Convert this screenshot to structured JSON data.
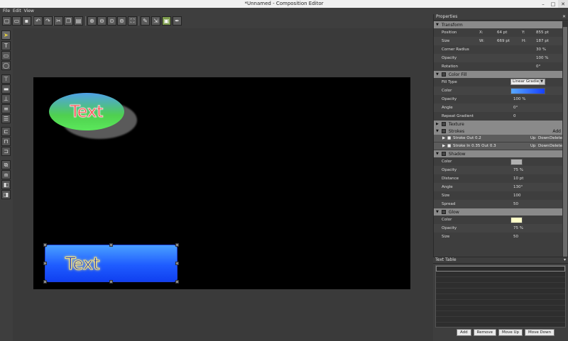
{
  "window": {
    "title": "*Unnamed - Composition Editor",
    "minimize": "–",
    "maximize": "□",
    "close": "✕"
  },
  "menu": [
    "File",
    "Edit",
    "View"
  ],
  "toolbar_icons": [
    "new-doc-icon",
    "open-folder-icon",
    "save-icon",
    "undo-icon",
    "redo-icon",
    "cut-icon",
    "copy-icon",
    "paste-icon",
    "zoom-in-icon",
    "zoom-out-icon",
    "zoom-fit-icon",
    "zoom-actual-icon",
    "fullscreen-icon",
    "edit-icon",
    "export-icon",
    "image-icon",
    "eyedropper-icon"
  ],
  "canvas": {
    "ellipse_text": "Text",
    "rect_text": "Text"
  },
  "properties": {
    "title": "Properties",
    "transform": {
      "label": "Transform",
      "position_label": "Position",
      "x_label": "X:",
      "x_value": "64 pt",
      "y_label": "Y:",
      "y_value": "855 pt",
      "size_label": "Size",
      "w_label": "W:",
      "w_value": "669 pt",
      "h_label": "H:",
      "h_value": "187 pt",
      "corner_label": "Corner Radius",
      "corner_value": "30 %",
      "opacity_label": "Opacity",
      "opacity_value": "100 %",
      "rotation_label": "Rotation",
      "rotation_value": "0°"
    },
    "color_fill": {
      "label": "Color Fill",
      "fill_type_label": "Fill Type",
      "fill_type_value": "Linear Gradient",
      "color_label": "Color",
      "opacity_label": "Opacity",
      "opacity_value": "100 %",
      "angle_label": "Angle",
      "angle_value": "0°",
      "repeat_label": "Repeat Gradient",
      "repeat_value": "0"
    },
    "texture": {
      "label": "Texture"
    },
    "strokes": {
      "label": "Strokes",
      "add": "Add",
      "items": [
        {
          "name": "Stroke Out 0.2",
          "up": "Up",
          "down": "Down",
          "del": "Delete"
        },
        {
          "name": "Stroke In 0.35 Out 0.3",
          "up": "Up",
          "down": "Down",
          "del": "Delete"
        }
      ]
    },
    "shadow": {
      "label": "Shadow",
      "color_label": "Color",
      "opacity_label": "Opacity",
      "opacity_value": "75 %",
      "distance_label": "Distance",
      "distance_value": "10 pt",
      "angle_label": "Angle",
      "angle_value": "130°",
      "size_label": "Size",
      "size_value": "100",
      "spread_label": "Spread",
      "spread_value": "50"
    },
    "glow": {
      "label": "Glow",
      "color_label": "Color",
      "opacity_label": "Opacity",
      "opacity_value": "75 %",
      "size_label": "Size",
      "size_value": "50"
    }
  },
  "colors": {
    "fill_swatch": "#2a6bff",
    "shadow_swatch": "#b0b0b0",
    "glow_swatch": "#ffffc8"
  },
  "text_table": {
    "title": "Text Table",
    "buttons": {
      "add": "Add",
      "remove": "Remove",
      "move_up": "Move Up",
      "move_down": "Move Down"
    }
  }
}
